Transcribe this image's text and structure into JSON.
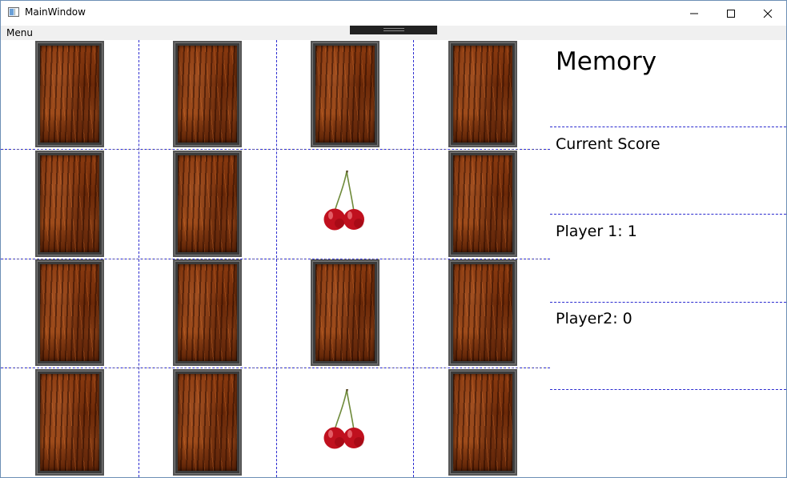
{
  "window": {
    "title": "MainWindow"
  },
  "menu": {
    "label": "Menu"
  },
  "board": {
    "columns": 4,
    "rows": 4,
    "cards": [
      {
        "state": "face-down"
      },
      {
        "state": "face-down"
      },
      {
        "state": "face-down"
      },
      {
        "state": "face-down"
      },
      {
        "state": "face-down"
      },
      {
        "state": "face-down"
      },
      {
        "state": "face-up",
        "image": "cherry-icon"
      },
      {
        "state": "face-down"
      },
      {
        "state": "face-down"
      },
      {
        "state": "face-down"
      },
      {
        "state": "face-down"
      },
      {
        "state": "face-down"
      },
      {
        "state": "face-down"
      },
      {
        "state": "face-down"
      },
      {
        "state": "face-up",
        "image": "cherry-icon"
      },
      {
        "state": "face-down"
      }
    ]
  },
  "panel": {
    "title": "Memory",
    "score_heading": "Current Score",
    "player1": "Player 1: 1",
    "player2": "Player2: 0"
  },
  "colors": {
    "grid_line": "#2b2bd0",
    "card_back": "#7a3210",
    "card_frame": "#3b3b3b",
    "cherry": "#c0101e"
  }
}
